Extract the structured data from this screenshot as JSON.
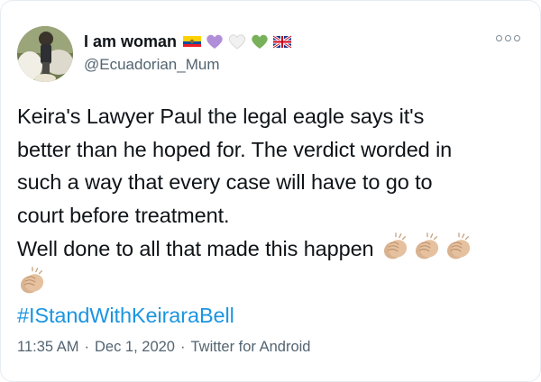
{
  "tweet": {
    "display_name": "I am woman",
    "handle": "@Ecuadorian_Mum",
    "name_emojis": [
      "ecuador-flag",
      "purple-heart",
      "white-heart",
      "green-heart",
      "uk-flag"
    ],
    "text_lines": [
      "Keira's Lawyer Paul the legal eagle says it's",
      "better than he hoped for. The verdict worded in",
      "such a way that every case will have to go to",
      "court before treatment.",
      "Well done to all that made this happen"
    ],
    "hashtag": "#IStandWithKeiraraBell",
    "time": "11:35 AM",
    "separator": "·",
    "date": "Dec 1, 2020",
    "source": "Twitter for Android"
  },
  "colors": {
    "text": "#0f1419",
    "muted": "#536471",
    "link": "#1b95e0",
    "border": "#e6ecf0"
  }
}
